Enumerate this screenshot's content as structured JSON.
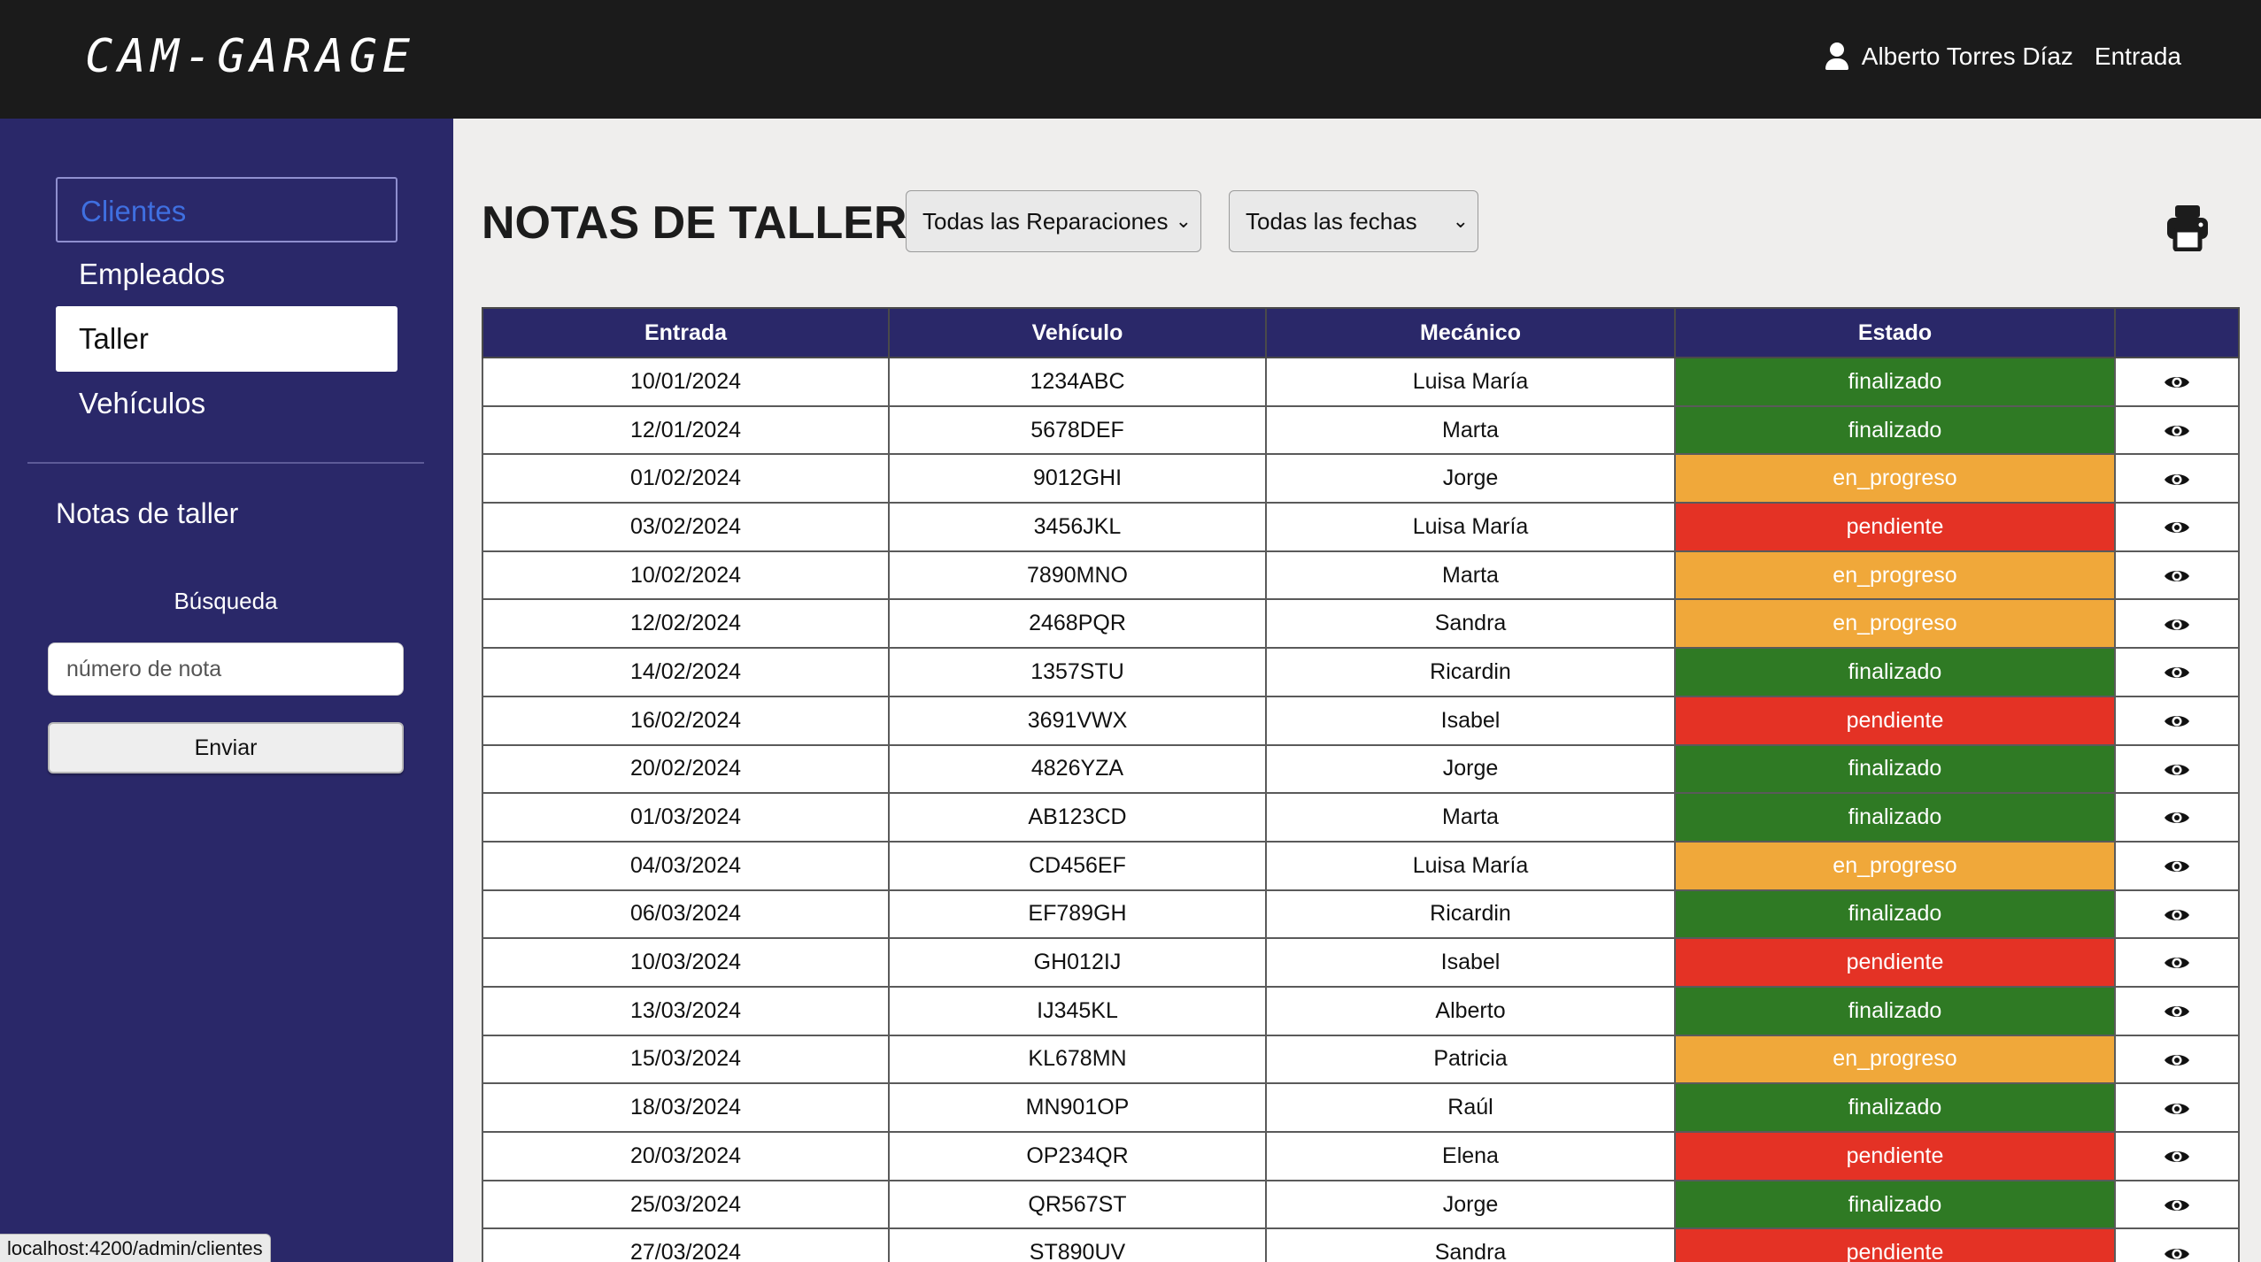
{
  "header": {
    "logo": "CAM-GARAGE",
    "user_name": "Alberto Torres Díaz",
    "login_label": "Entrada"
  },
  "sidebar": {
    "items": [
      {
        "label": "Clientes",
        "state": "outlined"
      },
      {
        "label": "Empleados",
        "state": "normal"
      },
      {
        "label": "Taller",
        "state": "active"
      },
      {
        "label": "Vehículos",
        "state": "normal"
      }
    ],
    "section_title": "Notas de taller",
    "search_label": "Búsqueda",
    "search_placeholder": "número de nota",
    "submit_label": "Enviar"
  },
  "status_url": "localhost:4200/admin/clientes",
  "main": {
    "title": "NOTAS DE TALLER",
    "filter_repairs": "Todas las Reparaciones",
    "filter_dates": "Todas las fechas",
    "print_icon": "printer-icon",
    "columns": [
      "Entrada",
      "Vehículo",
      "Mecánico",
      "Estado",
      ""
    ],
    "rows": [
      {
        "entrada": "10/01/2024",
        "vehiculo": "1234ABC",
        "mecanico": "Luisa María",
        "estado": "finalizado"
      },
      {
        "entrada": "12/01/2024",
        "vehiculo": "5678DEF",
        "mecanico": "Marta",
        "estado": "finalizado"
      },
      {
        "entrada": "01/02/2024",
        "vehiculo": "9012GHI",
        "mecanico": "Jorge",
        "estado": "en_progreso"
      },
      {
        "entrada": "03/02/2024",
        "vehiculo": "3456JKL",
        "mecanico": "Luisa María",
        "estado": "pendiente"
      },
      {
        "entrada": "10/02/2024",
        "vehiculo": "7890MNO",
        "mecanico": "Marta",
        "estado": "en_progreso"
      },
      {
        "entrada": "12/02/2024",
        "vehiculo": "2468PQR",
        "mecanico": "Sandra",
        "estado": "en_progreso"
      },
      {
        "entrada": "14/02/2024",
        "vehiculo": "1357STU",
        "mecanico": "Ricardin",
        "estado": "finalizado"
      },
      {
        "entrada": "16/02/2024",
        "vehiculo": "3691VWX",
        "mecanico": "Isabel",
        "estado": "pendiente"
      },
      {
        "entrada": "20/02/2024",
        "vehiculo": "4826YZA",
        "mecanico": "Jorge",
        "estado": "finalizado"
      },
      {
        "entrada": "01/03/2024",
        "vehiculo": "AB123CD",
        "mecanico": "Marta",
        "estado": "finalizado"
      },
      {
        "entrada": "04/03/2024",
        "vehiculo": "CD456EF",
        "mecanico": "Luisa María",
        "estado": "en_progreso"
      },
      {
        "entrada": "06/03/2024",
        "vehiculo": "EF789GH",
        "mecanico": "Ricardin",
        "estado": "finalizado"
      },
      {
        "entrada": "10/03/2024",
        "vehiculo": "GH012IJ",
        "mecanico": "Isabel",
        "estado": "pendiente"
      },
      {
        "entrada": "13/03/2024",
        "vehiculo": "IJ345KL",
        "mecanico": "Alberto",
        "estado": "finalizado"
      },
      {
        "entrada": "15/03/2024",
        "vehiculo": "KL678MN",
        "mecanico": "Patricia",
        "estado": "en_progreso"
      },
      {
        "entrada": "18/03/2024",
        "vehiculo": "MN901OP",
        "mecanico": "Raúl",
        "estado": "finalizado"
      },
      {
        "entrada": "20/03/2024",
        "vehiculo": "OP234QR",
        "mecanico": "Elena",
        "estado": "pendiente"
      },
      {
        "entrada": "25/03/2024",
        "vehiculo": "QR567ST",
        "mecanico": "Jorge",
        "estado": "finalizado"
      },
      {
        "entrada": "27/03/2024",
        "vehiculo": "ST890UV",
        "mecanico": "Sandra",
        "estado": "pendiente"
      }
    ]
  },
  "colors": {
    "sidebar_bg": "#2a2869",
    "topbar_bg": "#1b1b1b",
    "finalizado": "#2f7a24",
    "en_progreso": "#f0a83a",
    "pendiente": "#e43225",
    "link_blue": "#3f6fe0"
  }
}
